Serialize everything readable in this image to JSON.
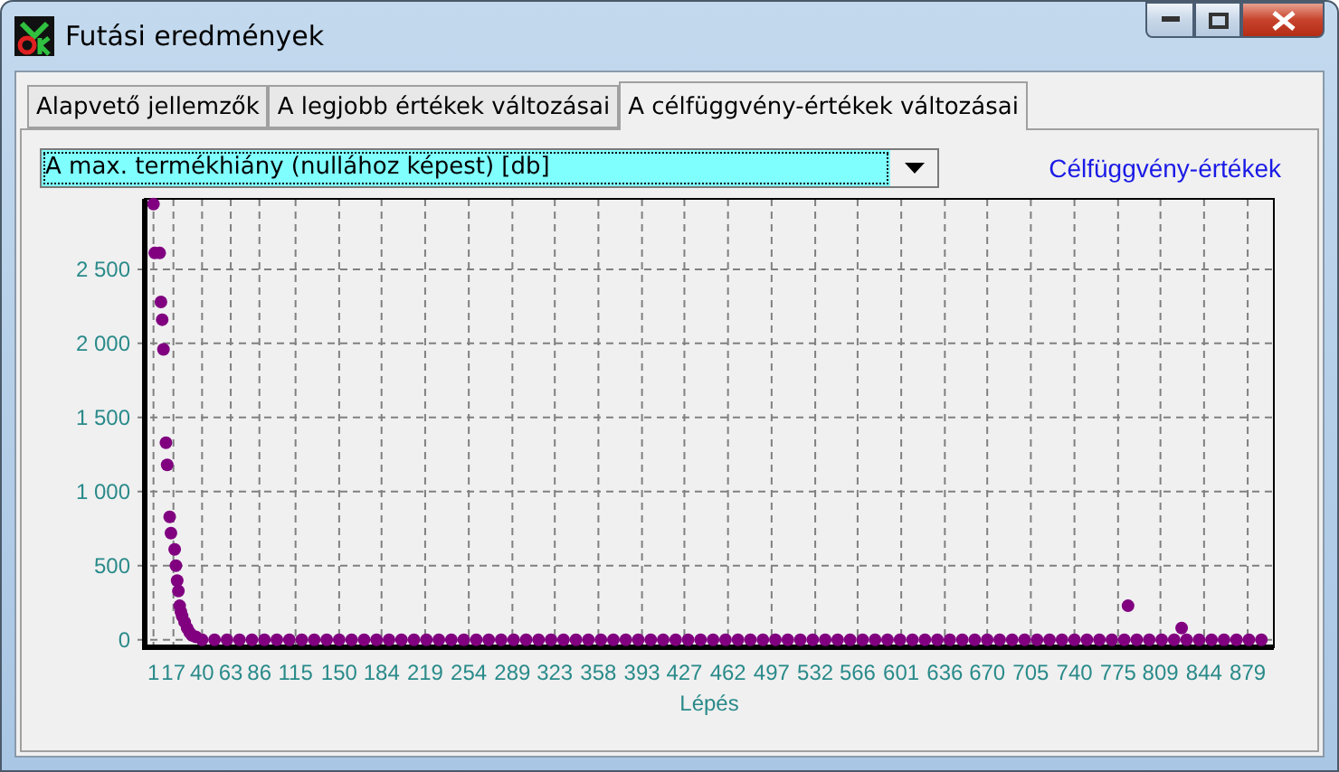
{
  "window": {
    "title": "Futási eredmények"
  },
  "tabs": [
    {
      "label": "Alapvető jellemzők",
      "selected": false
    },
    {
      "label": "A legjobb értékek változásai",
      "selected": false
    },
    {
      "label": "A célfüggvény-értékek változásai",
      "selected": true
    }
  ],
  "selector": {
    "value": "A max. termékhiány (nullához képest) [db]"
  },
  "chart": {
    "chart_data": {
      "type": "scatter",
      "xlabel": "Lépés",
      "grid": true,
      "x": [
        1,
        2,
        6,
        7,
        8,
        9,
        11,
        12,
        14,
        15,
        18,
        19,
        20,
        21,
        22,
        23,
        24,
        26,
        28,
        30,
        32,
        35,
        40,
        50,
        60,
        70,
        80,
        90,
        100,
        110,
        120,
        130,
        140,
        150,
        160,
        170,
        180,
        190,
        200,
        210,
        220,
        230,
        240,
        250,
        260,
        270,
        280,
        290,
        300,
        310,
        320,
        330,
        340,
        350,
        360,
        370,
        380,
        390,
        400,
        410,
        420,
        430,
        440,
        450,
        460,
        470,
        480,
        490,
        500,
        510,
        520,
        530,
        540,
        550,
        560,
        570,
        580,
        590,
        600,
        610,
        620,
        630,
        640,
        650,
        660,
        670,
        680,
        690,
        700,
        710,
        720,
        730,
        740,
        750,
        760,
        770,
        780,
        783,
        790,
        800,
        810,
        820,
        826,
        830,
        840,
        850,
        860,
        870,
        880,
        890
      ],
      "series": [
        {
          "name": "Célfüggvény-értékek",
          "color": "#800080",
          "values": [
            2940,
            2610,
            2610,
            2280,
            2160,
            1960,
            1330,
            1180,
            830,
            720,
            610,
            500,
            400,
            330,
            230,
            190,
            160,
            120,
            80,
            50,
            30,
            20,
            0,
            0,
            0,
            0,
            0,
            0,
            0,
            0,
            0,
            0,
            0,
            0,
            0,
            0,
            0,
            0,
            0,
            0,
            0,
            0,
            0,
            0,
            0,
            0,
            0,
            0,
            0,
            0,
            0,
            0,
            0,
            0,
            0,
            0,
            0,
            0,
            0,
            0,
            0,
            0,
            0,
            0,
            0,
            0,
            0,
            0,
            0,
            0,
            0,
            0,
            0,
            0,
            0,
            0,
            0,
            0,
            0,
            0,
            0,
            0,
            0,
            0,
            0,
            0,
            0,
            0,
            0,
            0,
            0,
            0,
            0,
            0,
            0,
            0,
            0,
            230,
            0,
            0,
            0,
            0,
            80,
            0,
            0,
            0,
            0,
            0,
            0,
            0
          ]
        }
      ],
      "xlim": [
        -6,
        900
      ],
      "ylim": [
        -50,
        2975
      ],
      "xticks": [
        1,
        17,
        40,
        63,
        86,
        115,
        150,
        184,
        219,
        254,
        289,
        323,
        358,
        393,
        427,
        462,
        497,
        532,
        566,
        601,
        636,
        670,
        705,
        740,
        775,
        809,
        844,
        879
      ],
      "yticks": [
        {
          "value": 0,
          "label": "0"
        },
        {
          "value": 500,
          "label": "500"
        },
        {
          "value": 1000,
          "label": "1 000"
        },
        {
          "value": 1500,
          "label": "1 500"
        },
        {
          "value": 2000,
          "label": "2 000"
        },
        {
          "value": 2500,
          "label": "2 500"
        }
      ]
    }
  }
}
